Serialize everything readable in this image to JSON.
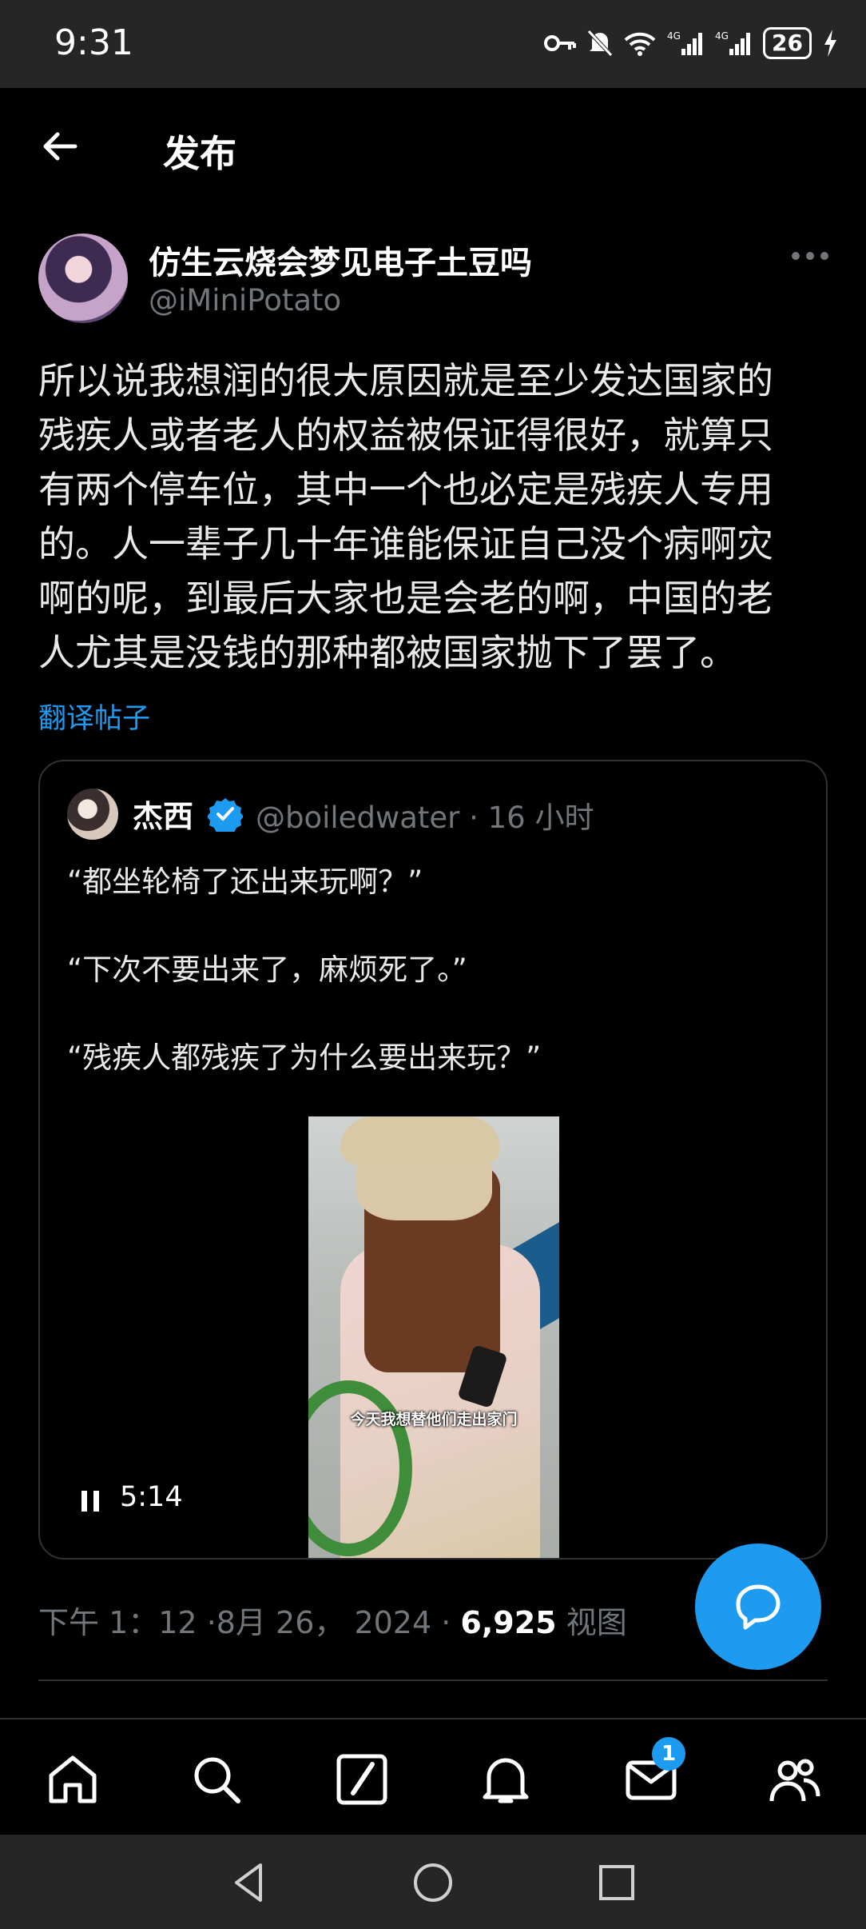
{
  "status_bar": {
    "time": "9:31",
    "battery": "26"
  },
  "header": {
    "title": "发布"
  },
  "post": {
    "author_name": "仿生云烧会梦见电子土豆吗",
    "author_handle": "@iMiniPotato",
    "lines": [
      "所以说我想润的很大原因就是至少发达国家的",
      "残疾人或者老人的权益被保证得很好，就算只",
      "有两个停车位，其中一个也必定是残疾人专用",
      "的。人一辈子几十年谁能保证自己没个病啊灾",
      "啊的呢，到最后大家也是会老的啊，中国的老",
      "人尤其是没钱的那种都被国家抛下了罢了。"
    ],
    "translate_label": "翻译帖子",
    "timestamp": "下午 1：12 ·8月 26， 2024 · ",
    "views_count": "6,925",
    "views_label": " 视图"
  },
  "quote": {
    "author_name": "杰西",
    "author_handle": "@boiledwater · 16 小时",
    "lines": [
      "“都坐轮椅了还出来玩啊？”",
      "“下次不要出来了，麻烦死了。”",
      "“残疾人都残疾了为什么要出来玩？”"
    ],
    "video": {
      "caption": "今天我想替他们走出家门",
      "duration": "5:14"
    }
  },
  "tab_bar": {
    "items": [
      "home-icon",
      "search-icon",
      "grok-icon",
      "notifications-icon",
      "messages-icon",
      "communities-icon"
    ],
    "messages_badge": "1"
  },
  "colors": {
    "accent": "#1d9bf0",
    "background": "#000000",
    "muted": "#71767b"
  }
}
